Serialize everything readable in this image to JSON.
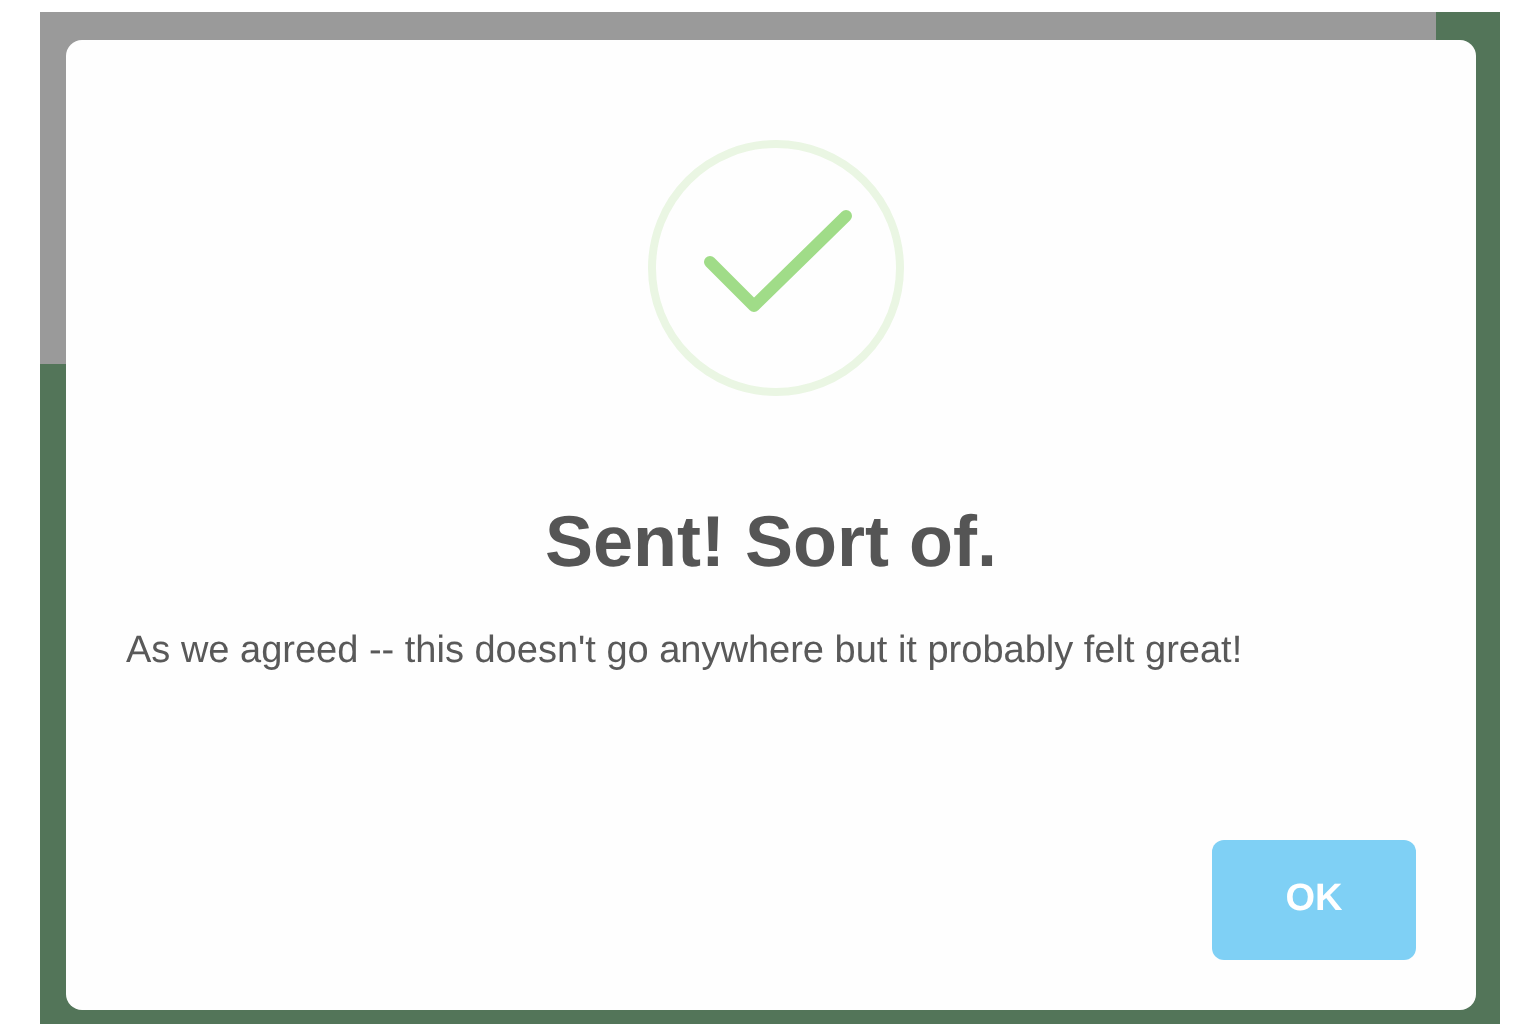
{
  "dialog": {
    "title": "Sent! Sort of.",
    "message": "As we agreed -- this doesn't go anywhere but it probably felt great!",
    "buttons": [
      "OK"
    ]
  }
}
